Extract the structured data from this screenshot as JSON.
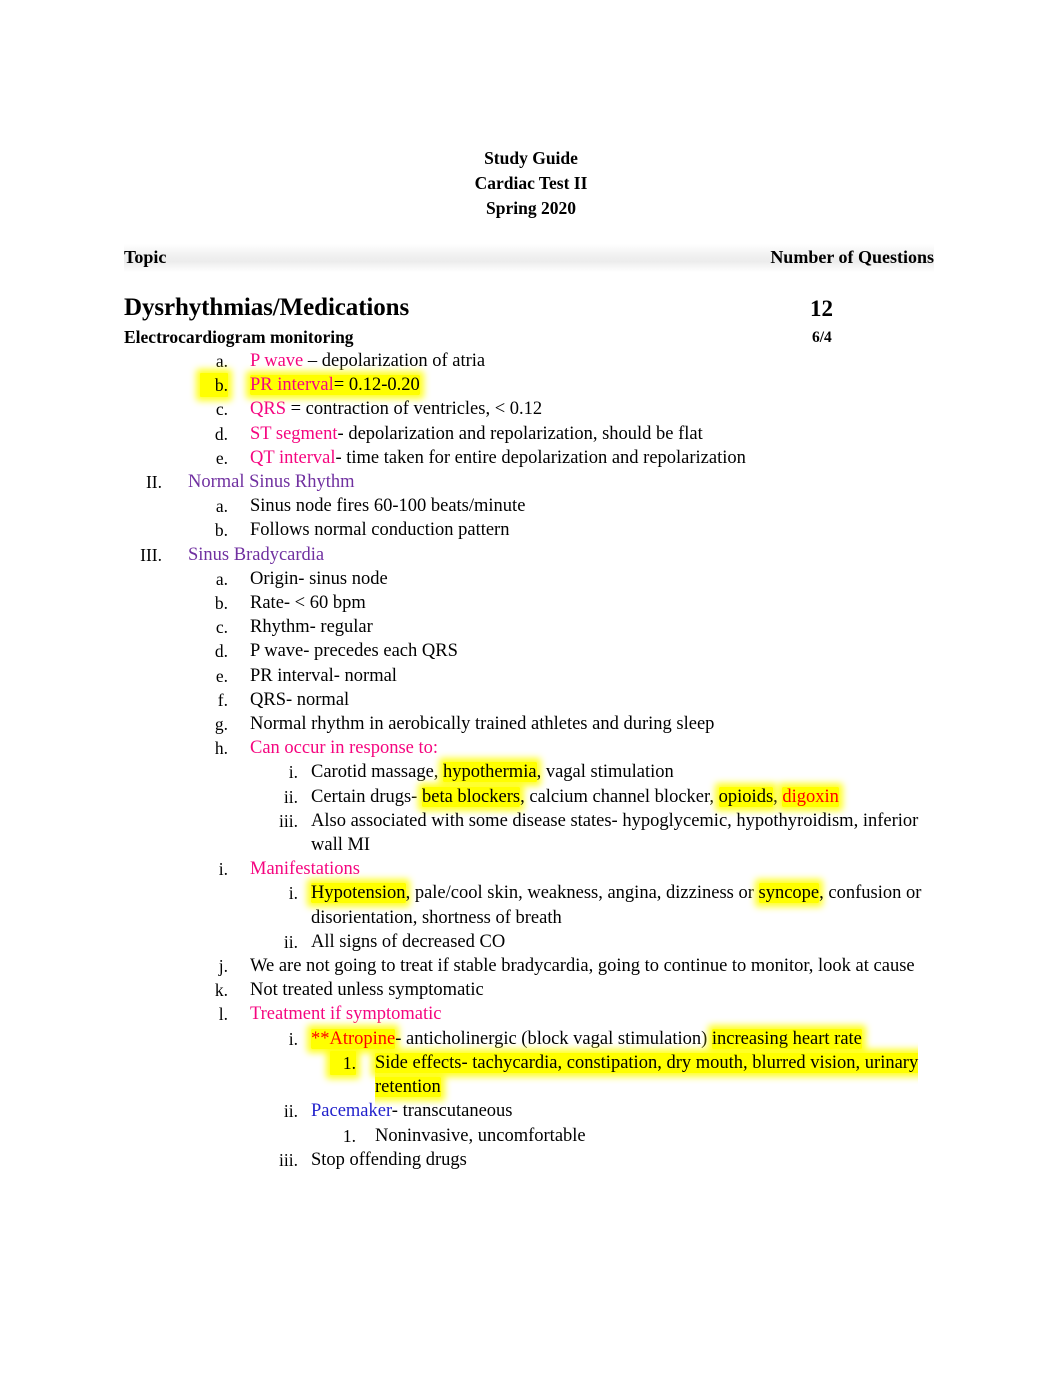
{
  "document": {
    "title_lines": [
      "Study Guide",
      "Cardiac Test II",
      "Spring 2020"
    ],
    "columns": {
      "topic_label": "Topic",
      "questions_label": "Number of Questions"
    },
    "section": {
      "heading": "Dysrhythmias/Medications",
      "heading_count": "12",
      "subheading": "Electrocardiogram monitoring",
      "subheading_count": "6/4"
    },
    "colors": {
      "magenta": "#f5057f",
      "purple": "#7030a0",
      "red": "#ff0000",
      "blue": "#2222cc",
      "highlight": "#ffff00"
    },
    "items": {
      "ecg_a_term": "P wave",
      "ecg_a_rest": " – depolarization of atria",
      "ecg_b_term": "PR interval",
      "ecg_b_rest": "= 0.12-0.20",
      "ecg_c_term": "QRS",
      "ecg_c_rest": " = contraction of ventricles, < 0.12",
      "ecg_d_term": "ST segment",
      "ecg_d_rest": "- depolarization and repolarization, should be flat",
      "ecg_e_term": "QT interval",
      "ecg_e_rest": "- time taken for entire depolarization and repolarization",
      "nsr_heading": "Normal Sinus Rhythm",
      "nsr_a": "Sinus node fires 60-100 beats/minute",
      "nsr_b": "Follows normal conduction pattern",
      "sb_heading": "Sinus Bradycardia",
      "sb_a": "Origin- sinus node",
      "sb_b": "Rate- < 60 bpm",
      "sb_c": "Rhythm- regular",
      "sb_d": "P wave- precedes each QRS",
      "sb_e": "PR interval- normal",
      "sb_f": "QRS- normal",
      "sb_g": "Normal rhythm in aerobically trained athletes and during sleep",
      "sb_h": "Can occur in response to:",
      "sb_h_i_pre": "Carotid massage, ",
      "sb_h_i_hl": "hypothermia",
      "sb_h_i_post": ", vagal stimulation",
      "sb_h_ii_pre": "Certain drugs- ",
      "sb_h_ii_hl1": "beta blockers",
      "sb_h_ii_mid": ", calcium channel blocker, ",
      "sb_h_ii_hl2": "opioids",
      "sb_h_ii_mid2": ", ",
      "sb_h_ii_hl3": "digoxin",
      "sb_h_iii": "Also associated with some disease states- hypoglycemic, hypothyroidism, inferior wall MI",
      "sb_i": "Manifestations",
      "sb_i_i_hl1": "Hypotension",
      "sb_i_i_mid": ", pale/cool skin, weakness, angina, dizziness or ",
      "sb_i_i_hl2": "syncope",
      "sb_i_i_post": ", confusion or disorientation, shortness of breath",
      "sb_i_ii": "All signs of decreased CO",
      "sb_j": "We are not going to treat if stable bradycardia, going to continue to monitor, look at cause",
      "sb_k": "Not treated unless symptomatic",
      "sb_l": "Treatment if symptomatic",
      "sb_l_i_term": "**Atropine",
      "sb_l_i_mid": "- anticholinergic (block vagal stimulation) ",
      "sb_l_i_hl": "increasing heart rate",
      "sb_l_i_1": "Side effects- tachycardia, constipation, dry mouth, blurred vision, urinary retention",
      "sb_l_ii_term": "Pacemaker",
      "sb_l_ii_rest": "- transcutaneous",
      "sb_l_ii_1": "Noninvasive, uncomfortable",
      "sb_l_iii": "Stop offending drugs"
    },
    "markers": {
      "m_a": "a.",
      "m_b": "b.",
      "m_c": "c.",
      "m_d": "d.",
      "m_e": "e.",
      "m_f": "f.",
      "m_g": "g.",
      "m_h": "h.",
      "m_i": "i.",
      "m_j": "j.",
      "m_k": "k.",
      "m_l": "l.",
      "m_II": "II.",
      "m_III": "III.",
      "m_ri": "i.",
      "m_rii": "ii.",
      "m_riii": "iii.",
      "m_n1": "1."
    }
  }
}
